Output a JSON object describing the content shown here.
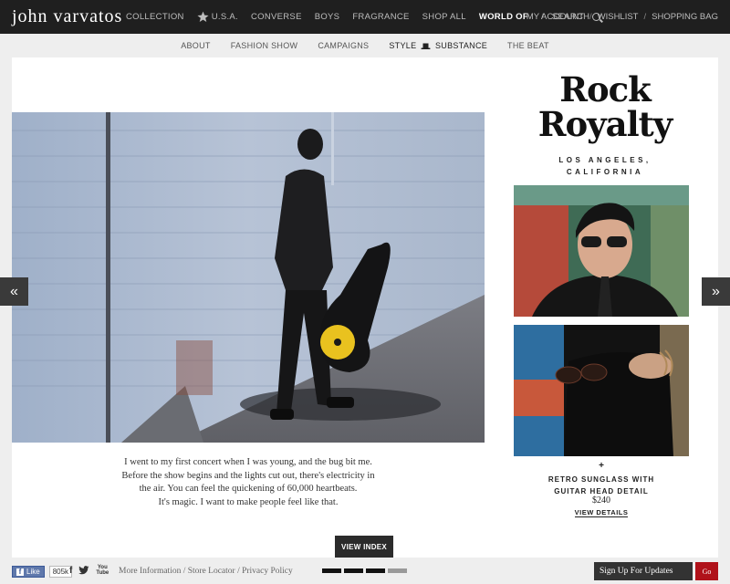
{
  "header": {
    "logo": "john varvatos",
    "nav": [
      "COLLECTION",
      "U.S.A.",
      "CONVERSE",
      "BOYS",
      "FRAGRANCE",
      "SHOP ALL",
      "WORLD OF",
      "/",
      "SEARCH"
    ],
    "account": [
      "MY ACCOUNT",
      "WISHLIST",
      "SHOPPING BAG"
    ],
    "separator": "/"
  },
  "subnav": {
    "items": [
      "ABOUT",
      "FASHION SHOW",
      "CAMPAIGNS"
    ],
    "style_left": "STYLE",
    "style_right": "SUBSTANCE",
    "last": "THE BEAT"
  },
  "story": {
    "title_line1": "Rock",
    "title_line2": "Royalty",
    "location_line1": "LOS ANGELES,",
    "location_line2": "CALIFORNIA",
    "caption": [
      "I went to my first concert when I was young, and the bug bit me.",
      "Before the show begins and the lights cut out, there's electricity in",
      "the air. You can feel the quickening of 60,000 heartbeats.",
      "It's magic. I want to make people feel like that."
    ],
    "view_index": "VIEW INDEX"
  },
  "product": {
    "plus": "+",
    "name_line1": "RETRO SUNGLASS WITH",
    "name_line2": "GUITAR HEAD DETAIL",
    "price": "$240",
    "details": "VIEW DETAILS"
  },
  "arrows": {
    "left": "«",
    "right": "»"
  },
  "footer": {
    "like": "Like",
    "like_count": "805k",
    "facebook": "f",
    "youtube_top": "You",
    "youtube_bottom": "Tube",
    "links": [
      "More Information",
      "Store Locator",
      "Privacy Policy"
    ],
    "link_sep": " / ",
    "signup": "Sign Up For Updates",
    "go": "Go"
  }
}
